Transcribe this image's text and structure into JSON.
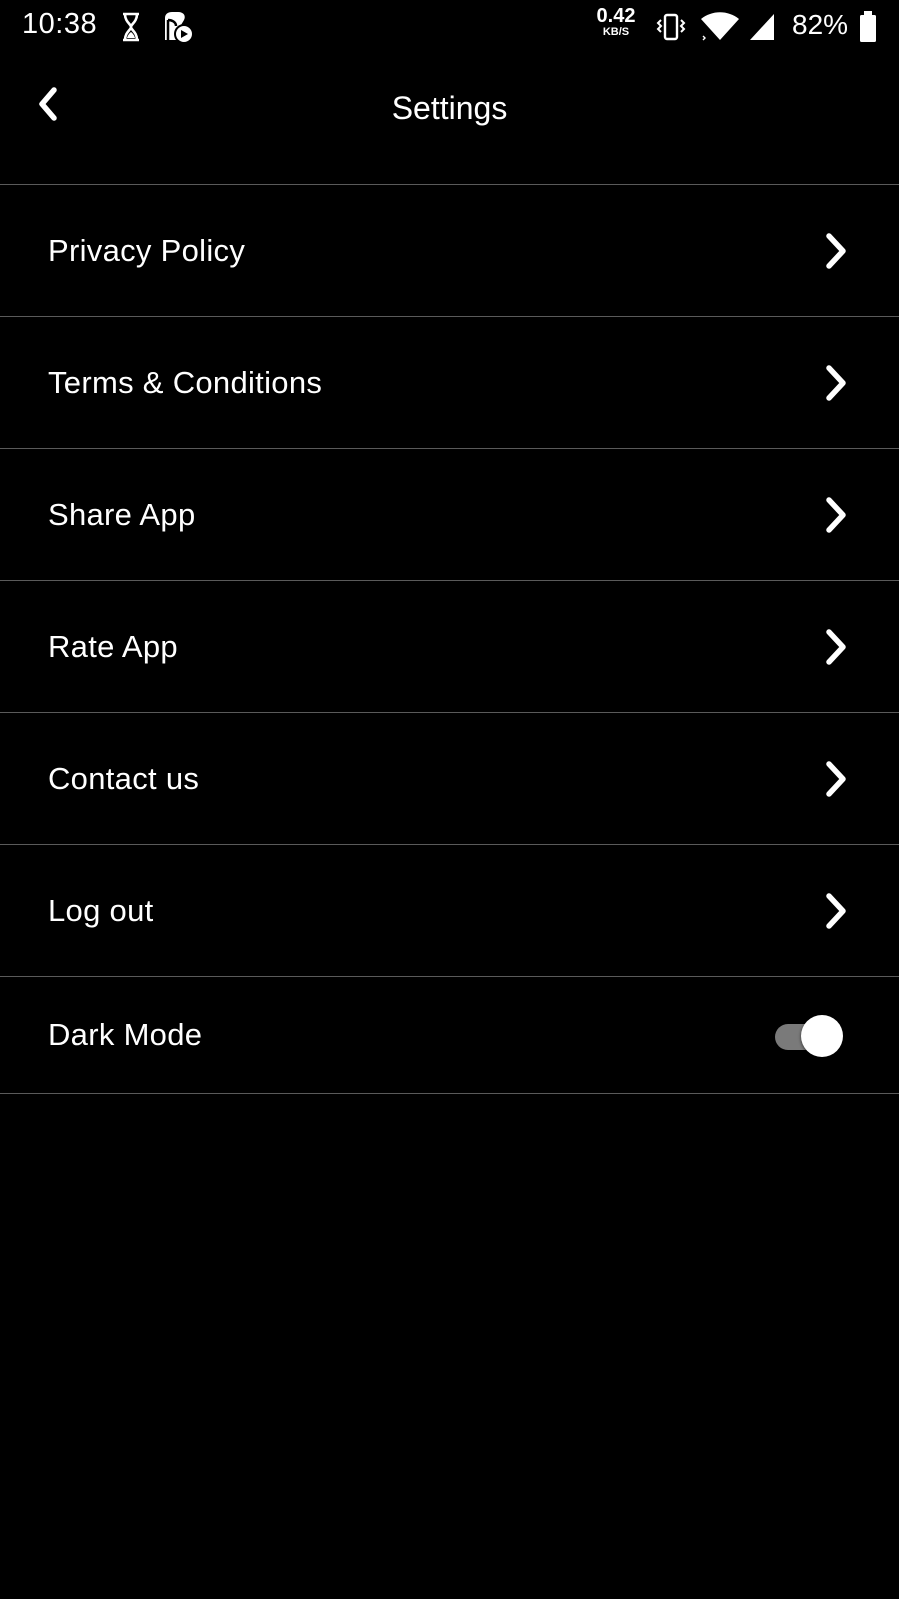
{
  "status_bar": {
    "time": "10:38",
    "network_speed_value": "0.42",
    "network_speed_unit": "KB/S",
    "battery_percent": "82%",
    "icons": [
      "hourglass-icon",
      "app-notification-icon",
      "vibrate-icon",
      "wifi-icon",
      "cell-signal-icon",
      "battery-icon"
    ]
  },
  "header": {
    "title": "Settings",
    "back_icon": "chevron-left-icon"
  },
  "settings": {
    "items": [
      {
        "label": "Privacy Policy",
        "icon": "chevron-right-icon"
      },
      {
        "label": "Terms & Conditions",
        "icon": "chevron-right-icon"
      },
      {
        "label": "Share App",
        "icon": "chevron-right-icon"
      },
      {
        "label": "Rate App",
        "icon": "chevron-right-icon"
      },
      {
        "label": "Contact us",
        "icon": "chevron-right-icon"
      },
      {
        "label": "Log out",
        "icon": "chevron-right-icon"
      }
    ],
    "dark_mode": {
      "label": "Dark Mode",
      "enabled": true
    }
  },
  "colors": {
    "background": "#000000",
    "text": "#ffffff",
    "divider": "#5a5a5a",
    "toggle_track": "#7a7a7a",
    "toggle_knob": "#ffffff"
  }
}
